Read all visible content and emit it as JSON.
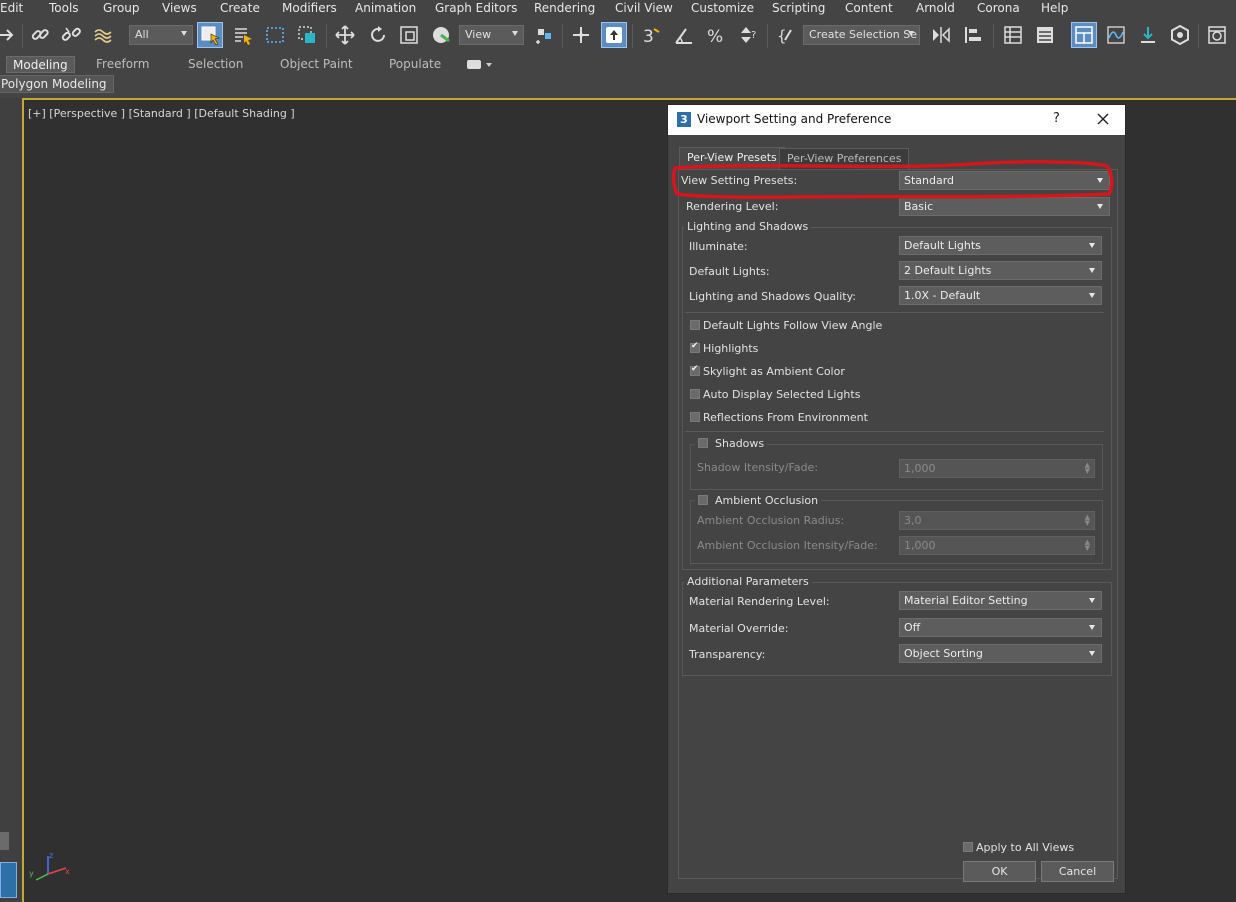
{
  "menu": [
    "Edit",
    "Tools",
    "Group",
    "Views",
    "Create",
    "Modifiers",
    "Animation",
    "Graph Editors",
    "Rendering",
    "Civil View",
    "Customize",
    "Scripting",
    "Content",
    "Arnold",
    "Corona",
    "Help"
  ],
  "toolbar": {
    "selection_filter": "All",
    "ref_coord": "View",
    "named_selection": "Create Selection Se",
    "icons": [
      "undo-arrow-icon",
      "link-icon",
      "unlink-icon",
      "bind-spacewarp-icon",
      "select-object-icon",
      "select-by-name-icon",
      "rect-region-icon",
      "window-crossing-icon",
      "move-icon",
      "rotate-icon",
      "scale-icon",
      "place-icon",
      "snap-3-icon",
      "angle-snap-icon",
      "percent-snap-icon",
      "spinner-snap-icon",
      "edit-named-selection-icon",
      "mirror-icon",
      "align-icon",
      "scene-explorer-icon",
      "layer-explorer-icon",
      "ribbon-toggle-icon",
      "curve-editor-icon",
      "schematic-icon",
      "material-editor-icon",
      "render-setup-icon"
    ]
  },
  "ribbon": {
    "tabs": [
      "Modeling",
      "Freeform",
      "Selection",
      "Object Paint",
      "Populate"
    ],
    "active_tab": "Modeling",
    "sub_label": "Polygon Modeling"
  },
  "viewport": {
    "label": "[+] [Perspective ] [Standard ] [Default Shading ]",
    "axis": {
      "x": "x",
      "y": "y",
      "z": "z"
    }
  },
  "dialog": {
    "title": "Viewport Setting and Preference",
    "help": "?",
    "tabs": [
      "Per-View Presets",
      "Per-View Preferences"
    ],
    "view_setting_presets": {
      "label": "View Setting Presets:",
      "value": "Standard"
    },
    "rendering_level": {
      "label": "Rendering Level:",
      "value": "Basic"
    },
    "lighting_group": {
      "title": "Lighting and Shadows",
      "illuminate": {
        "label": "Illuminate:",
        "value": "Default Lights"
      },
      "default_lights": {
        "label": "Default Lights:",
        "value": "2 Default Lights"
      },
      "quality": {
        "label": "Lighting and Shadows Quality:",
        "value": "1.0X - Default"
      },
      "checkboxes": [
        {
          "label": "Default Lights Follow View Angle",
          "checked": false
        },
        {
          "label": "Highlights",
          "checked": true
        },
        {
          "label": "Skylight as Ambient Color",
          "checked": true
        },
        {
          "label": "Auto Display Selected Lights",
          "checked": false
        },
        {
          "label": "Reflections From Environment",
          "checked": false
        }
      ],
      "shadows": {
        "label": "Shadows",
        "checked": false,
        "intensity_label": "Shadow Itensity/Fade:",
        "intensity_value": "1,000"
      },
      "ambient_occlusion": {
        "label": "Ambient Occlusion",
        "checked": false,
        "radius_label": "Ambient Occlusion Radius:",
        "radius_value": "3,0",
        "intensity_label": "Ambient Occlusion Itensity/Fade:",
        "intensity_value": "1,000"
      }
    },
    "additional_group": {
      "title": "Additional Parameters",
      "material_rendering_level": {
        "label": "Material Rendering Level:",
        "value": "Material Editor Setting"
      },
      "material_override": {
        "label": "Material Override:",
        "value": "Off"
      },
      "transparency": {
        "label": "Transparency:",
        "value": "Object Sorting"
      }
    },
    "apply_all": {
      "label": "Apply to All Views",
      "checked": false
    },
    "ok": "OK",
    "cancel": "Cancel"
  },
  "colors": {
    "accent": "#5d8cc0",
    "viewport_border": "#c6a53c",
    "highlight_annotation": "#d6151c"
  }
}
